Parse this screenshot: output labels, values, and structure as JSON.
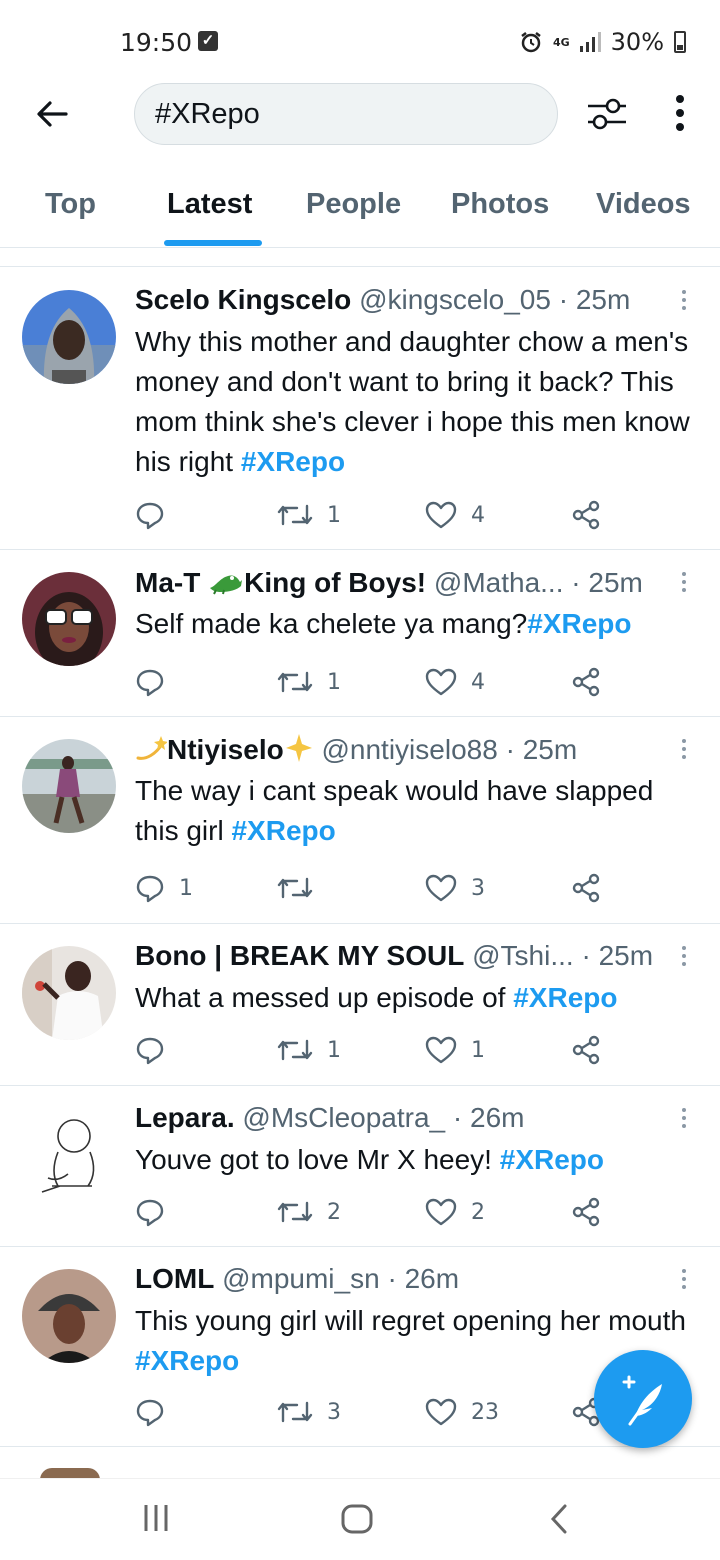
{
  "status_bar": {
    "time": "19:50",
    "network": "4G",
    "battery": "30%",
    "battery_level": 0.3
  },
  "search": {
    "query": "#XRepo"
  },
  "tabs": [
    {
      "label": "Top",
      "active": false
    },
    {
      "label": "Latest",
      "active": true
    },
    {
      "label": "People",
      "active": false
    },
    {
      "label": "Photos",
      "active": false
    },
    {
      "label": "Videos",
      "active": false
    }
  ],
  "colors": {
    "accent": "#1d9bf0",
    "text_primary": "#0f1419",
    "text_secondary": "#536471"
  },
  "tweets": [
    {
      "name": "Scelo Kingscelo",
      "handle": "@kingscelo_05",
      "time": "25m",
      "text": "Why this mother and daughter chow a men's money and don't want to bring it back? This mom think she's clever i hope this men know his right ",
      "hashtag": "#XRepo",
      "replies": "",
      "retweets": "1",
      "likes": "4"
    },
    {
      "name_pre": "Ma-T",
      "name_post": "King of Boys!",
      "name_emoji": "crocodile",
      "handle": "@Matha...",
      "time": "25m",
      "text": "Self made ka chelete ya mang?",
      "hashtag": "#XRepo",
      "replies": "",
      "retweets": "1",
      "likes": "4"
    },
    {
      "name": "Ntiyiselo",
      "name_emoji_pre": "dizzy",
      "name_emoji_post": "sparkle",
      "handle": "@nntiyiselo88",
      "time": "25m",
      "text": "The way i cant speak would have slapped this girl ",
      "hashtag": "#XRepo",
      "replies": "1",
      "retweets": "",
      "likes": "3"
    },
    {
      "name": "Bono | BREAK MY SOUL",
      "handle": "@Tshi...",
      "time": "25m",
      "text": "What a messed up episode of ",
      "hashtag": "#XRepo",
      "replies": "",
      "retweets": "1",
      "likes": "1"
    },
    {
      "name": "Lepara.",
      "handle": "@MsCleopatra_",
      "time": "26m",
      "text": "Youve got to love Mr X heey! ",
      "hashtag": "#XRepo",
      "replies": "",
      "retweets": "2",
      "likes": "2"
    },
    {
      "name": "LOML",
      "handle": "@mpumi_sn",
      "time": "26m",
      "text": "This young girl will regret opening her mouth ",
      "hashtag": "#XRepo",
      "replies": "",
      "retweets": "3",
      "likes": "23"
    }
  ]
}
